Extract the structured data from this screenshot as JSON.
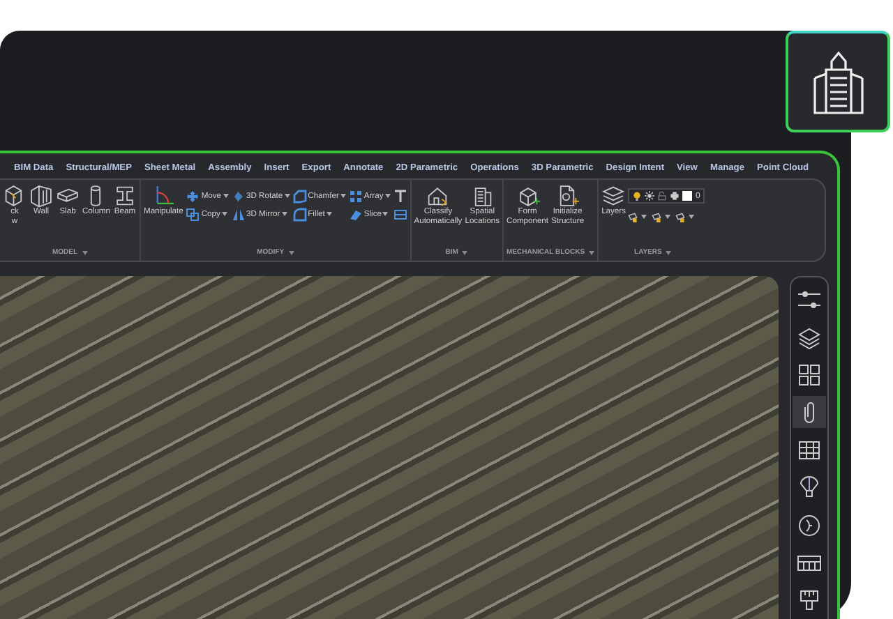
{
  "ribbon": {
    "tabs": [
      {
        "label": "BIM Data",
        "selected": false
      },
      {
        "label": "Structural/MEP",
        "selected": false
      },
      {
        "label": "Sheet Metal",
        "selected": false
      },
      {
        "label": "Assembly",
        "selected": false
      },
      {
        "label": "Insert",
        "selected": false
      },
      {
        "label": "Export",
        "selected": false
      },
      {
        "label": "Annotate",
        "selected": false
      },
      {
        "label": "2D Parametric",
        "selected": false
      },
      {
        "label": "Operations",
        "selected": false
      },
      {
        "label": "3D Parametric",
        "selected": false
      },
      {
        "label": "Design Intent",
        "selected": false
      },
      {
        "label": "View",
        "selected": false
      },
      {
        "label": "Manage",
        "selected": false
      },
      {
        "label": "Point Cloud",
        "selected": false
      }
    ],
    "panels": [
      {
        "title": "MODEL",
        "tools": [
          {
            "kind": "large",
            "label": "ck\nw"
          },
          {
            "kind": "large",
            "label": "Wall"
          },
          {
            "kind": "large",
            "label": "Slab"
          },
          {
            "kind": "large",
            "label": "Column"
          },
          {
            "kind": "large",
            "label": "Beam"
          }
        ]
      },
      {
        "title": "MODIFY",
        "tools": [
          {
            "kind": "large",
            "label": "Manipulate"
          },
          {
            "kind": "small",
            "label": "Move"
          },
          {
            "kind": "small",
            "label": "Copy"
          },
          {
            "kind": "small",
            "label": "3D Rotate"
          },
          {
            "kind": "small",
            "label": "3D Mirror"
          },
          {
            "kind": "small",
            "label": "Chamfer"
          },
          {
            "kind": "small",
            "label": "Fillet"
          },
          {
            "kind": "small",
            "label": "Array"
          },
          {
            "kind": "small",
            "label": "Slice"
          },
          {
            "kind": "icon"
          },
          {
            "kind": "icon"
          }
        ]
      },
      {
        "title": "BIM",
        "tools": [
          {
            "kind": "large",
            "label": "Classify\nAutomatically"
          },
          {
            "kind": "large",
            "label": "Spatial\nLocations"
          }
        ]
      },
      {
        "title": "MECHANICAL BLOCKS",
        "tools": [
          {
            "kind": "large",
            "label": "Form\nComponent"
          },
          {
            "kind": "large",
            "label": "Initialize\nStructure"
          }
        ]
      },
      {
        "title": "LAYERS",
        "tools": [
          {
            "kind": "large",
            "label": "Layers"
          },
          {
            "kind": "layerbar",
            "label": "0"
          }
        ]
      }
    ]
  },
  "sidebar": {
    "items": [
      {
        "selected": false
      },
      {
        "selected": false
      },
      {
        "selected": false
      },
      {
        "selected": true
      },
      {
        "selected": false
      },
      {
        "selected": false
      },
      {
        "selected": false
      },
      {
        "selected": false
      },
      {
        "selected": false
      }
    ]
  }
}
